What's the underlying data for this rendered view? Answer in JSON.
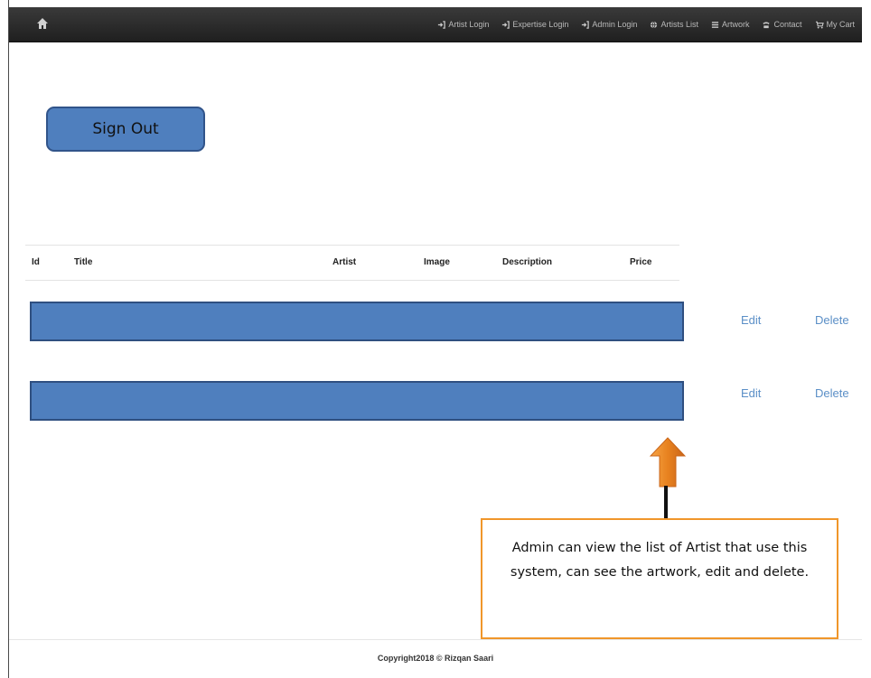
{
  "nav": {
    "items": [
      {
        "label": "Artist Login",
        "icon": "login-icon"
      },
      {
        "label": "Expertise Login",
        "icon": "login-icon"
      },
      {
        "label": "Admin Login",
        "icon": "login-icon"
      },
      {
        "label": "Artists List",
        "icon": "globe-icon"
      },
      {
        "label": "Artwork",
        "icon": "list-icon"
      },
      {
        "label": "Contact",
        "icon": "phone-icon"
      },
      {
        "label": "My Cart",
        "icon": "cart-icon"
      }
    ]
  },
  "signout": {
    "label": "Sign Out"
  },
  "table": {
    "headers": [
      "Id",
      "Title",
      "Artist",
      "Image",
      "Description",
      "Price"
    ],
    "rows": [
      {
        "edit": "Edit",
        "delete": "Delete"
      },
      {
        "edit": "Edit",
        "delete": "Delete"
      }
    ]
  },
  "callout": {
    "text": "Admin can view the list of Artist that use this system, can see the artwork, edit and delete.",
    "border_color": "#f0962a",
    "arrow_color": "#f0962a"
  },
  "footer": {
    "text": "Copyright2018 © Rizqan Saari"
  },
  "colors": {
    "navbar": "#2b2b2b",
    "row_fill": "#4f7fbe",
    "link": "#5b8fc7"
  }
}
